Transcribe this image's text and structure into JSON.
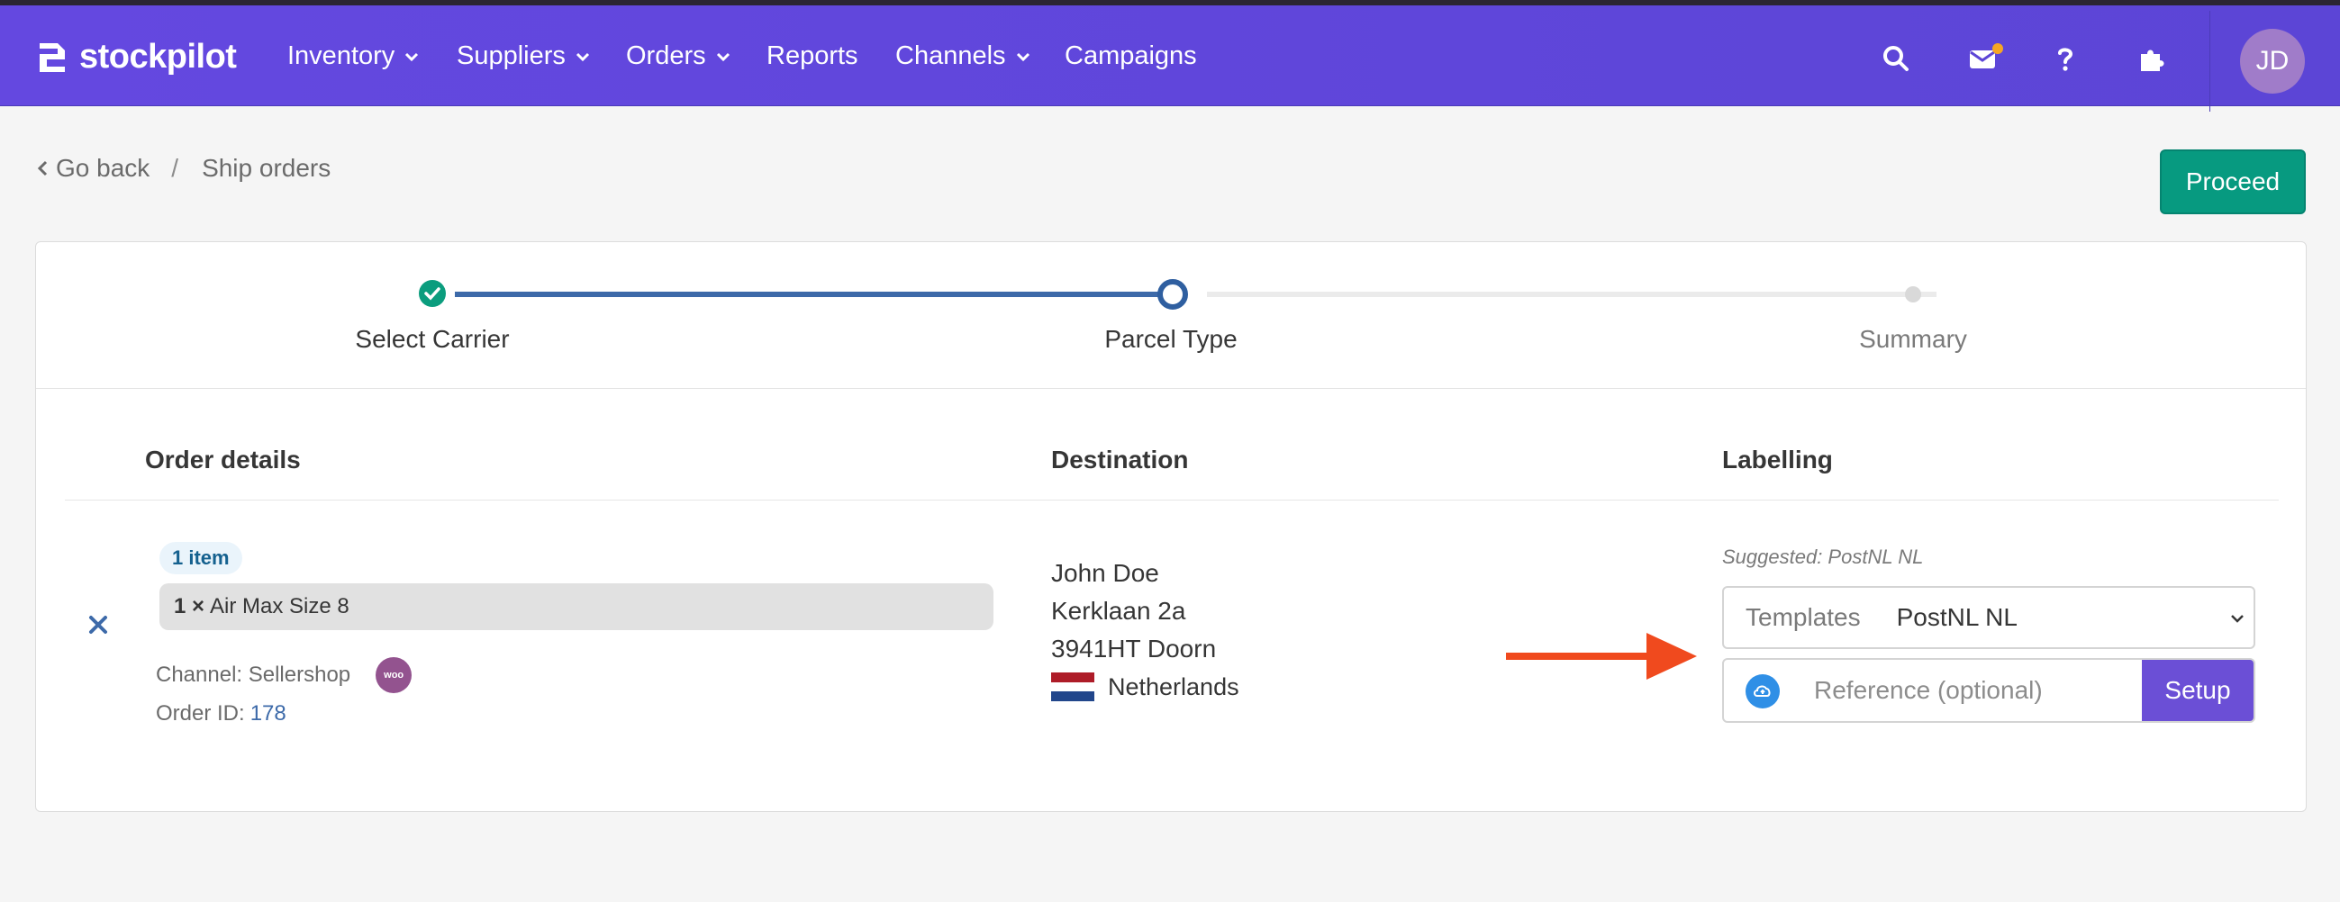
{
  "brand": {
    "name": "stockpilot"
  },
  "nav": {
    "items": [
      {
        "label": "Inventory",
        "has_dropdown": true
      },
      {
        "label": "Suppliers",
        "has_dropdown": true
      },
      {
        "label": "Orders",
        "has_dropdown": true
      },
      {
        "label": "Reports",
        "has_dropdown": false
      },
      {
        "label": "Channels",
        "has_dropdown": true
      },
      {
        "label": "Campaigns",
        "has_dropdown": false
      }
    ],
    "icons": [
      "search-icon",
      "mail-icon",
      "help-icon",
      "puzzle-icon"
    ],
    "avatar_initials": "JD"
  },
  "breadcrumb": {
    "back": "Go back",
    "separator": "/",
    "current": "Ship orders"
  },
  "actions": {
    "proceed": "Proceed"
  },
  "stepper": {
    "steps": [
      {
        "label": "Select Carrier",
        "state": "complete"
      },
      {
        "label": "Parcel Type",
        "state": "active"
      },
      {
        "label": "Summary",
        "state": "pending"
      }
    ]
  },
  "table": {
    "headers": {
      "order": "Order details",
      "destination": "Destination",
      "labelling": "Labelling"
    }
  },
  "order": {
    "item_count": "1 item",
    "quantity": "1 ×",
    "product": "Air Max Size 8",
    "channel_label": "Channel: Sellershop",
    "order_id_label": "Order ID:",
    "order_id": "178"
  },
  "destination": {
    "name": "John Doe",
    "street": "Kerklaan 2a",
    "city": "3941HT Doorn",
    "country": "Netherlands"
  },
  "labelling": {
    "suggested": "Suggested: PostNL NL",
    "templates_label": "Templates",
    "template_value": "PostNL NL",
    "reference_placeholder": "Reference (optional)",
    "setup": "Setup"
  },
  "colors": {
    "navbar": "#6448e0",
    "primary_green": "#079a80",
    "step_done": "#3d6aa9",
    "accent_purple": "#6b4fd6",
    "arrow": "#f04a1e"
  }
}
